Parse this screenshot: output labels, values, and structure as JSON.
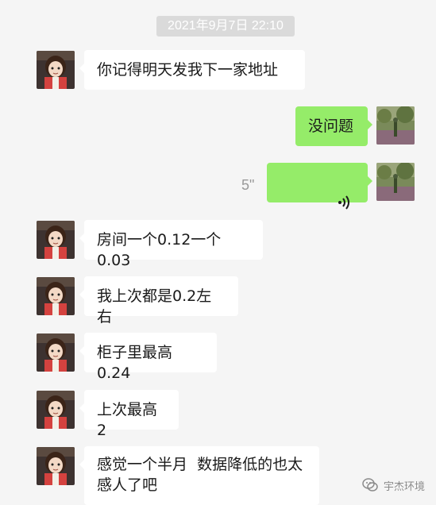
{
  "chat": {
    "timestamp": "2021年9月7日 22:10",
    "messages": [
      {
        "side": "left",
        "text": "你记得明天发我下一家地址"
      },
      {
        "side": "right",
        "text": "没问题"
      },
      {
        "side": "right",
        "type": "voice",
        "duration": "5\""
      },
      {
        "side": "left",
        "text": "房间一个0.12一个0.03"
      },
      {
        "side": "left",
        "text": "我上次都是0.2左右"
      },
      {
        "side": "left",
        "text": "柜子里最高0.24"
      },
      {
        "side": "left",
        "text": "上次最高2"
      },
      {
        "side": "left",
        "text": "感觉一个半月  数据降低的也太\n感人了吧"
      }
    ]
  },
  "watermark": {
    "text": "宇杰环境"
  },
  "icons": {
    "voice": "voice-wave-icon",
    "watermark": "wechat-logo-icon"
  },
  "colors": {
    "background": "#f5f5f5",
    "incoming_bubble": "#ffffff",
    "outgoing_bubble": "#95ec69",
    "timestamp_bg": "#dadada"
  }
}
